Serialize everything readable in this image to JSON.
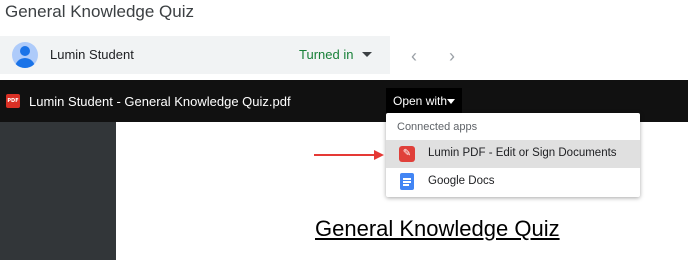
{
  "header": {
    "title": "General Knowledge Quiz"
  },
  "student": {
    "name": "Lumin Student",
    "status": "Turned in",
    "status_color": "#188038"
  },
  "viewer": {
    "file_badge": "PDF",
    "file_name": "Lumin Student - General Knowledge Quiz.pdf",
    "open_with_label": "Open with",
    "document_heading": "General Knowledge Quiz"
  },
  "open_with_menu": {
    "header": "Connected apps",
    "items": [
      {
        "label": "Lumin PDF - Edit or Sign Documents",
        "icon": "lumin-pdf-icon",
        "highlighted": true
      },
      {
        "label": "Google Docs",
        "icon": "google-docs-icon",
        "highlighted": false
      }
    ]
  },
  "colors": {
    "annotation_arrow": "#e53935",
    "viewer_background": "#323639",
    "lumin_icon": "#e0403a",
    "docs_icon": "#4285f4"
  }
}
